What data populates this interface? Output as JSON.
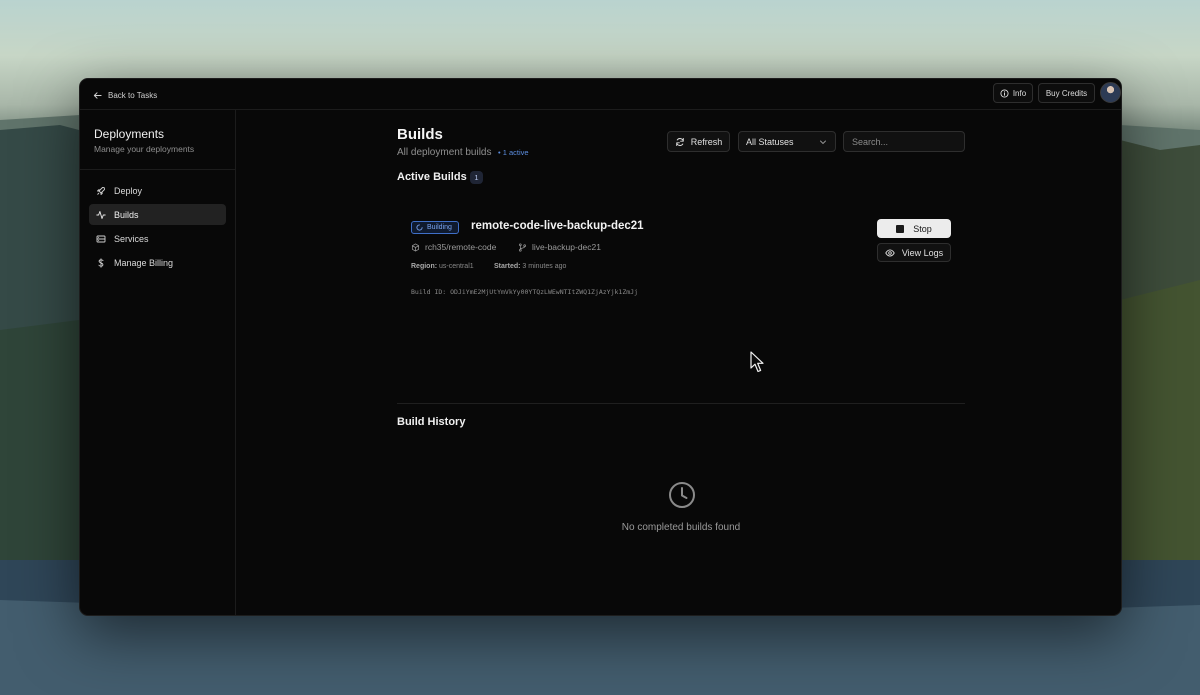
{
  "topbar": {
    "back_label": "Back to Tasks",
    "info_label": "Info",
    "buy_credits_label": "Buy Credits"
  },
  "sidebar": {
    "title": "Deployments",
    "subtitle": "Manage your deployments",
    "items": [
      {
        "label": "Deploy",
        "icon": "rocket-icon"
      },
      {
        "label": "Builds",
        "icon": "activity-icon",
        "active": true
      },
      {
        "label": "Services",
        "icon": "server-icon"
      },
      {
        "label": "Manage Billing",
        "icon": "dollar-icon"
      }
    ]
  },
  "main": {
    "title": "Builds",
    "subtitle": "All deployment builds",
    "active_summary": "• 1 active",
    "refresh_label": "Refresh",
    "status_filter": "All Statuses",
    "search_placeholder": "Search...",
    "active_builds_title": "Active Builds",
    "active_builds_count": "1",
    "build": {
      "status": "Building",
      "name": "remote-code-live-backup-dec21",
      "repo": "rch35/remote-code",
      "branch": "live-backup-dec21",
      "region_label": "Region:",
      "region": "us-central1",
      "started_label": "Started:",
      "started": "3 minutes ago",
      "build_id": "Build ID: ODJiYmE2MjUtYmVkYy00YTQzLWEwNTItZWQ1ZjAzYjk1ZmJj",
      "stop_label": "Stop",
      "logs_label": "View Logs"
    },
    "history_title": "Build History",
    "history_empty": "No completed builds found"
  },
  "colors": {
    "accent_blue": "#3f6fc8",
    "background": "#080808",
    "primary_button": "#ececec"
  }
}
